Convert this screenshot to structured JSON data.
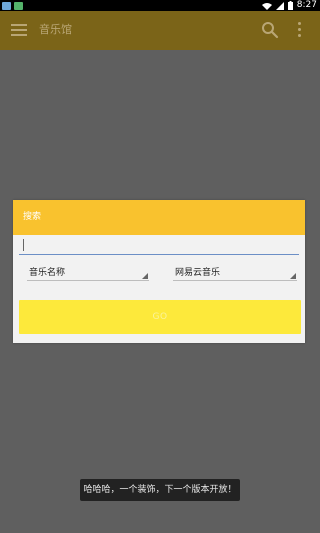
{
  "statusbar": {
    "time": "8:27"
  },
  "appbar": {
    "title": "音乐馆",
    "color": "#7b6418",
    "icons": [
      "menu-icon",
      "search-icon",
      "more-vert-icon"
    ]
  },
  "dialog": {
    "title": "搜索",
    "header_color": "#f9c22e",
    "input_value": "",
    "search_type": {
      "selected": "音乐名称"
    },
    "source": {
      "selected": "网易云音乐"
    },
    "go_label": "GO",
    "go_color": "#fde93b"
  },
  "toast": {
    "message": "哈哈哈，一个装饰，下一个版本开放！"
  }
}
